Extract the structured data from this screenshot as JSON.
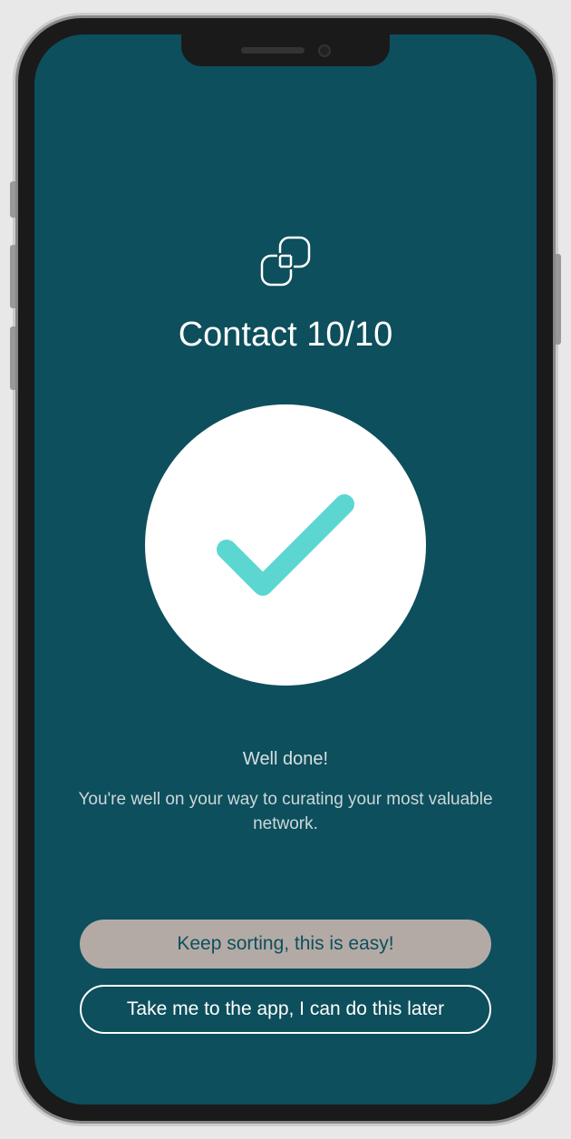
{
  "header": {
    "title": "Contact 10/10"
  },
  "success": {
    "heading": "Well done!",
    "message": "You're well on your way to curating your most valuable network."
  },
  "buttons": {
    "primary": "Keep sorting, this is easy!",
    "secondary": "Take me to the app, I can do this later"
  },
  "colors": {
    "background": "#0d4f5c",
    "accent": "#5cd6d0",
    "buttonPrimary": "#b3aaa5"
  }
}
